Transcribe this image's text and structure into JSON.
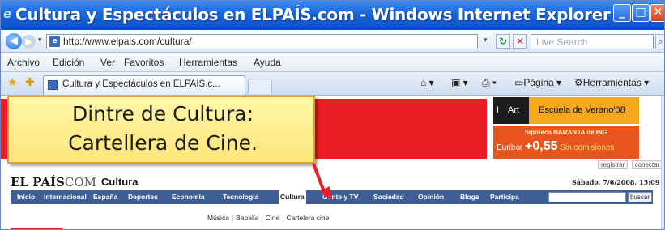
{
  "window": {
    "title": "Cultura y Espectáculos en ELPAÍS.com - Windows Internet Explorer"
  },
  "address_bar": {
    "url": "http://www.elpais.com/cultura/",
    "search_placeholder": "Live Search"
  },
  "menu": {
    "items": [
      "Archivo",
      "Edición",
      "Ver",
      "Favoritos",
      "Herramientas",
      "Ayuda"
    ]
  },
  "tabs": {
    "active_label": "Cultura y Espectáculos en ELPAÍS.c...",
    "tools": {
      "page_label": "Página",
      "tools_label": "Herramientas"
    }
  },
  "callout": {
    "line1": "Dintre de Cultura:",
    "line2": "Cartellera de Cine."
  },
  "ads": {
    "art_brand": "Art",
    "school": "Escuela de Verano'08",
    "bank_line": "hipoteca NARANJA de ING",
    "euribor_label": "Euribor",
    "euribor_value": "+0,55",
    "euribor_tail": "Sin comisiones"
  },
  "account": {
    "register": "registrar",
    "connect": "conectar"
  },
  "site": {
    "logo_main": "EL PAÍS",
    "logo_com": "COM",
    "section": "Cultura",
    "date": "Sábado, 7/6/2008, 15:09 h",
    "search_button": "buscar"
  },
  "nav": {
    "items": [
      "Inicio",
      "Internacional",
      "España",
      "Deportes",
      "Economía",
      "Tecnología",
      "Cultura",
      "Gente y TV",
      "Sociedad",
      "Opinión",
      "Blogs",
      "Participa"
    ],
    "active": "Cultura"
  },
  "subnav": {
    "items": [
      "Música",
      "Babelia",
      "Cine",
      "Cartelera cine"
    ]
  },
  "colors": {
    "titlebar": "#1764d8",
    "brand_red": "#ec1c24",
    "nav_blue": "#3f5f94",
    "callout_fill": "#fde57a",
    "arrow": "#e4202a"
  }
}
